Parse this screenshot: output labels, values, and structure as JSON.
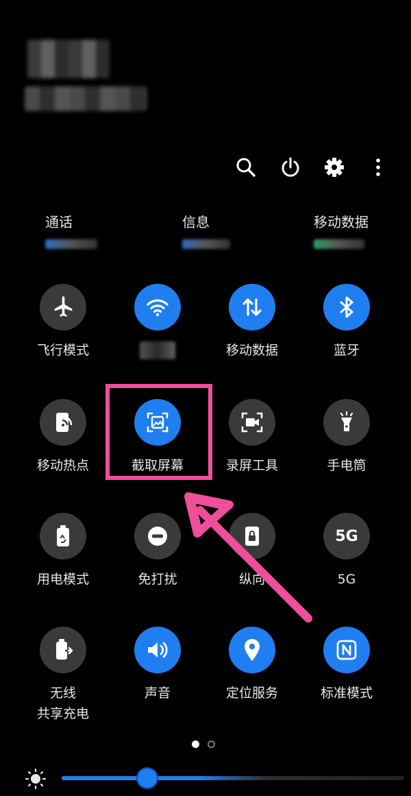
{
  "sims": [
    {
      "label": "通话"
    },
    {
      "label": "信息"
    },
    {
      "label": "移动数据"
    }
  ],
  "tiles": [
    {
      "label": "飞行模式",
      "icon": "airplane-icon",
      "state": "off"
    },
    {
      "label": "",
      "icon": "wifi-icon",
      "state": "on"
    },
    {
      "label": "移动数据",
      "icon": "mobile-data-icon",
      "state": "on"
    },
    {
      "label": "蓝牙",
      "icon": "bluetooth-icon",
      "state": "on"
    },
    {
      "label": "移动热点",
      "icon": "hotspot-icon",
      "state": "off"
    },
    {
      "label": "截取屏幕",
      "icon": "screenshot-icon",
      "state": "on"
    },
    {
      "label": "录屏工具",
      "icon": "screen-record-icon",
      "state": "off"
    },
    {
      "label": "手电筒",
      "icon": "flashlight-icon",
      "state": "off"
    },
    {
      "label": "用电模式",
      "icon": "battery-mode-icon",
      "state": "off"
    },
    {
      "label": "免打扰",
      "icon": "do-not-disturb-icon",
      "state": "off"
    },
    {
      "label": "纵向",
      "icon": "portrait-lock-icon",
      "state": "off"
    },
    {
      "label": "5G",
      "icon": "5g-icon",
      "state": "off"
    },
    {
      "label": "无线\n共享充电",
      "icon": "wireless-powershare-icon",
      "state": "off"
    },
    {
      "label": "声音",
      "icon": "sound-icon",
      "state": "on"
    },
    {
      "label": "定位服务",
      "icon": "location-icon",
      "state": "on"
    },
    {
      "label": "标准模式",
      "icon": "nfc-icon",
      "state": "on"
    }
  ],
  "icon_5g_text": "5G",
  "toolbar": {
    "icons": [
      "search-icon",
      "power-icon",
      "settings-gear-icon",
      "more-options-icon"
    ]
  },
  "pager": {
    "pages": 2,
    "active_page": 1
  },
  "brightness": {
    "level": 0.25,
    "icon": "brightness-sun-icon"
  },
  "colors": {
    "accent": "#1f7ef0",
    "tile_off": "#3a3a3a",
    "highlight": "#ee4f9a",
    "background": "#000000"
  }
}
